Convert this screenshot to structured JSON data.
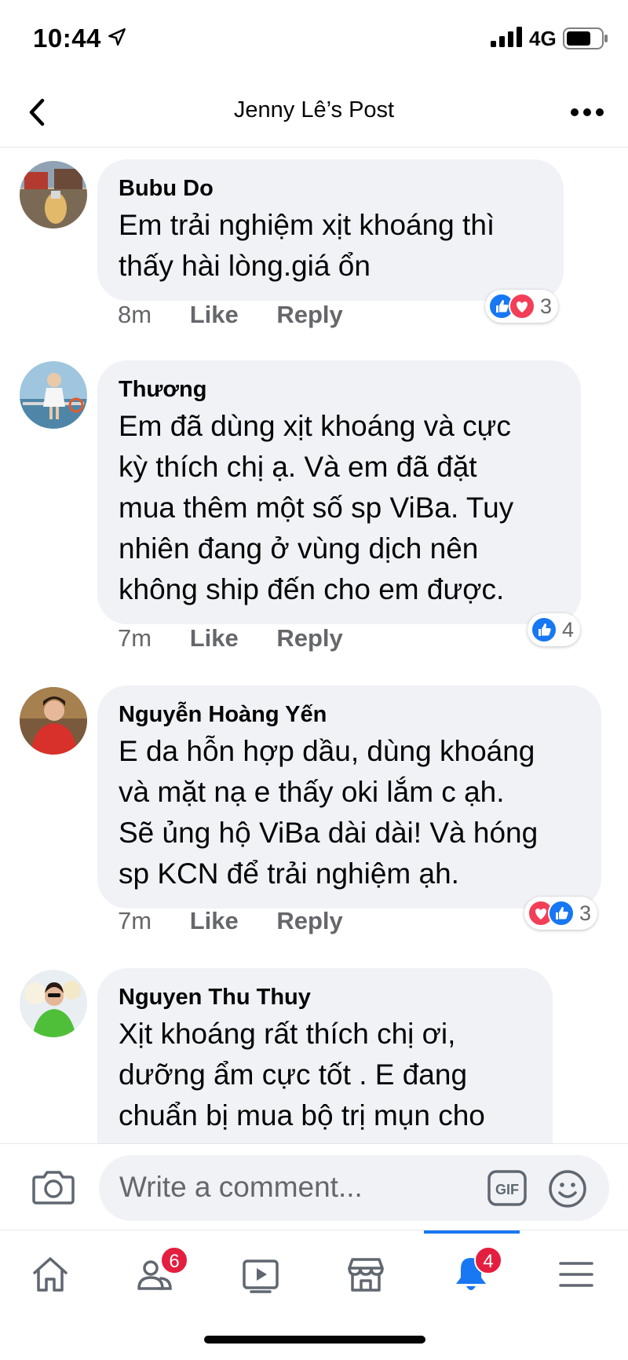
{
  "status_bar": {
    "time": "10:44",
    "network": "4G"
  },
  "header": {
    "title": "Jenny Lê’s Post"
  },
  "comments": [
    {
      "author": "Bubu Do",
      "lines": [
        "Em trải nghiệm xịt khoáng thì",
        "thấy hài lòng.giá ổn"
      ],
      "time": "8m",
      "like_label": "Like",
      "reply_label": "Reply",
      "reaction_count": "3"
    },
    {
      "author": "Thương",
      "lines": [
        "Em đã dùng xịt khoáng và cực",
        "kỳ thích chị ạ. Và em đã đặt",
        "mua thêm một số sp ViBa. Tuy",
        "nhiên đang ở vùng dịch nên",
        "không ship đến cho em được."
      ],
      "time": "7m",
      "like_label": "Like",
      "reply_label": "Reply",
      "reaction_count": "4"
    },
    {
      "author": "Nguyễn Hoàng Yến",
      "lines": [
        "E da hỗn hợp dầu, dùng khoáng",
        "và mặt nạ e thấy oki lắm c ạh.",
        "Sẽ ủng hộ ViBa dài dài! Và hóng",
        "sp KCN để trải nghiệm ạh."
      ],
      "time": "7m",
      "like_label": "Like",
      "reply_label": "Reply",
      "reaction_count": "3"
    },
    {
      "author": "Nguyen Thu Thuy",
      "lines": [
        "Xịt khoáng rất thích chị ơi,",
        "dưỡng ẩm cực tốt . E đang",
        "chuẩn bị mua bộ trị mụn cho"
      ]
    }
  ],
  "composer": {
    "placeholder": "Write a comment...",
    "gif_label": "GIF"
  },
  "tabbar": {
    "friends_badge": "6",
    "notifications_badge": "4",
    "active_tab": "notifications"
  },
  "colors": {
    "accent": "#1877f2",
    "bubble": "#f0f2f5",
    "love": "#f33e58",
    "badge": "#e41e3f",
    "meta": "#65676b"
  }
}
